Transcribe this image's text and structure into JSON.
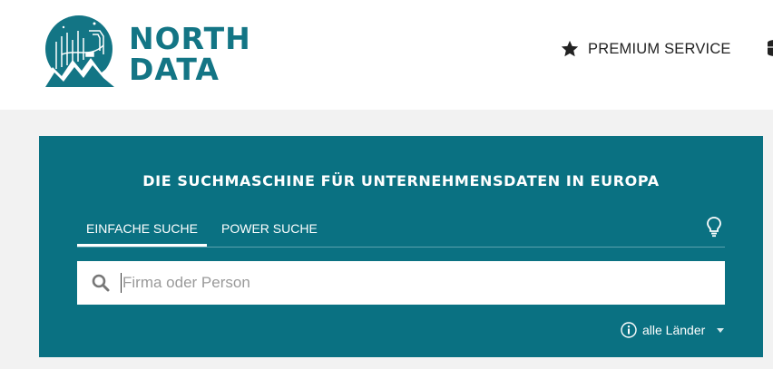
{
  "header": {
    "logo_line1": "NORTH",
    "logo_line2": "DATA",
    "premium_label": "PREMIUM SERVICE",
    "brand_color": "#137585"
  },
  "search": {
    "headline": "DIE SUCHMASCHINE FÜR UNTERNEHMENSDATEN IN EUROPA",
    "tabs": [
      {
        "label": "EINFACHE SUCHE",
        "active": true
      },
      {
        "label": "POWER SUCHE",
        "active": false
      }
    ],
    "placeholder": "Firma oder Person",
    "value": "",
    "country_filter": "alle Länder",
    "panel_color": "#0a7182"
  },
  "icons": {
    "premium": "star-icon",
    "tip": "lightbulb-icon",
    "search": "search-icon",
    "info": "info-icon",
    "dropdown": "caret-down-icon"
  }
}
